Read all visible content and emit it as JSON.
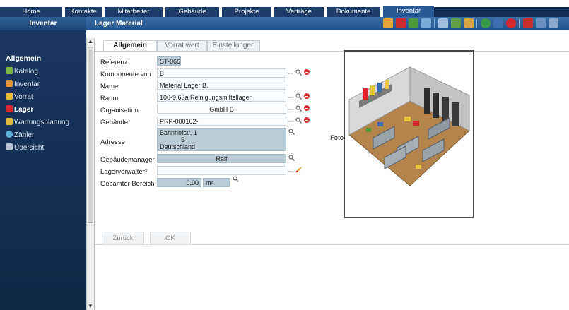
{
  "nav": {
    "tabs": [
      {
        "label": "Home"
      },
      {
        "label": "Kontakte"
      },
      {
        "label": "Mitarbeiter"
      },
      {
        "label": "Gebäude"
      },
      {
        "label": "Projekte"
      },
      {
        "label": "Verträge"
      },
      {
        "label": "Dokumente"
      },
      {
        "label": "Inventar"
      }
    ],
    "active_tab": "Inventar"
  },
  "subheader": {
    "section": "Inventar",
    "page": "Lager Material"
  },
  "sidebar": {
    "heading": "Allgemein",
    "items": [
      {
        "label": "Katalog",
        "icon": "catalog-icon"
      },
      {
        "label": "Inventar",
        "icon": "inventory-icon"
      },
      {
        "label": "Vorrat",
        "icon": "stock-icon"
      },
      {
        "label": "Lager",
        "icon": "warehouse-icon",
        "active": true
      },
      {
        "label": "Wartungsplanung",
        "icon": "maintenance-icon"
      },
      {
        "label": "Zähler",
        "icon": "meter-icon"
      },
      {
        "label": "Übersicht",
        "icon": "overview-icon"
      }
    ]
  },
  "content_tabs": [
    {
      "label": "Allgemein",
      "active": true
    },
    {
      "label": "Vorrat wert"
    },
    {
      "label": "Einstellungen"
    }
  ],
  "form": {
    "referenz": {
      "label": "Referenz",
      "value": "ST-066"
    },
    "komponente": {
      "label": "Komponente von",
      "value": "B"
    },
    "name": {
      "label": "Name",
      "value": "Material Lager B."
    },
    "raum": {
      "label": "Raum",
      "value": "100-9.63a  Reinigungsmittellager"
    },
    "organisation": {
      "label": "Organisation",
      "value": "GmbH B"
    },
    "gebaeude": {
      "label": "Gebäude",
      "value": "PRP-000162-"
    },
    "adresse": {
      "label": "Adresse",
      "line1": "Bahnhofstr. 1",
      "line2": "B",
      "line3": "Deutschland"
    },
    "gebaeudemanager": {
      "label": "Gebäudemanager",
      "value": "Ralf"
    },
    "lagerverwalter": {
      "label": "Lagerverwalter*",
      "value": ""
    },
    "gesamter_bereich": {
      "label": "Gesamter Bereich",
      "value": "0,00",
      "unit": "m²"
    }
  },
  "photo": {
    "label": "Foto"
  },
  "buttons": {
    "back": "Zurück",
    "ok": "OK"
  },
  "colors": {
    "nav_bg": "#162f55",
    "nav_active": "#2a5894",
    "subheader": "#2e5f96",
    "sidebar": "#1a3761",
    "field_highlight": "#b8cbd7"
  }
}
